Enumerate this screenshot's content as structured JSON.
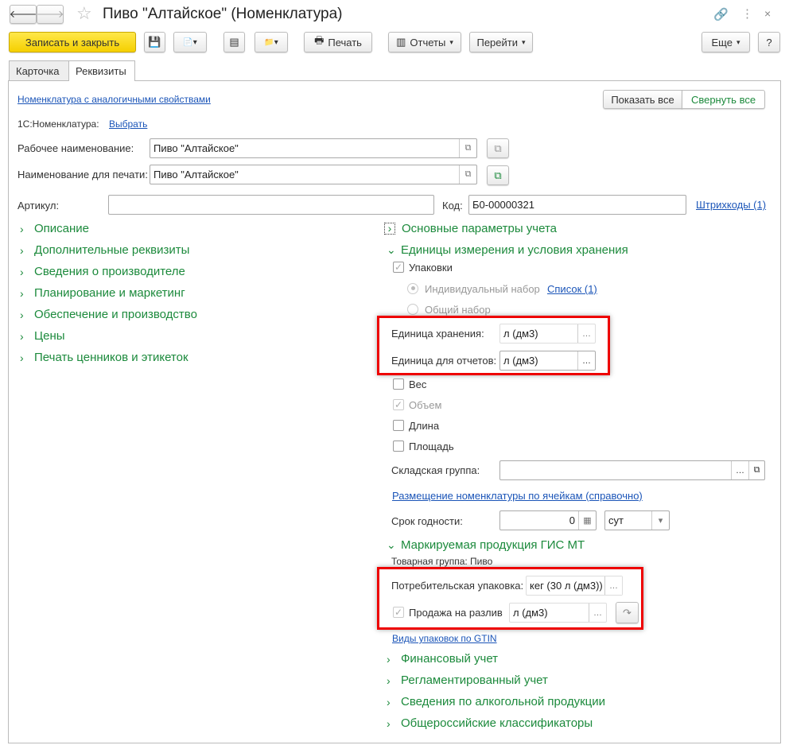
{
  "title": "Пиво \"Алтайское\" (Номенклатура)",
  "toolbar": {
    "save_close": "Записать и закрыть",
    "print": "Печать",
    "reports": "Отчеты",
    "goto": "Перейти",
    "more": "Еще",
    "help": "?"
  },
  "tabs": [
    {
      "label": "Карточка"
    },
    {
      "label": "Реквизиты",
      "active": true
    }
  ],
  "top": {
    "similar_link": "Номенклатура с аналогичными свойствами",
    "show_all": "Показать все",
    "collapse_all": "Свернуть все",
    "nom_label": "1С:Номенклатура:",
    "nom_link": "Выбрать"
  },
  "fields": {
    "work_name_label": "Рабочее наименование:",
    "work_name": "Пиво \"Алтайское\"",
    "print_name_label": "Наименование для печати:",
    "print_name": "Пиво \"Алтайское\"",
    "article_label": "Артикул:",
    "article": "",
    "code_label": "Код:",
    "code": "Б0-00000321",
    "barcodes": "Штрихкоды (1)"
  },
  "left_sections": [
    "Описание",
    "Дополнительные реквизиты",
    "Сведения о производителе",
    "Планирование и маркетинг",
    "Обеспечение и производство",
    "Цены",
    "Печать ценников и этикеток"
  ],
  "right": {
    "basic_params": "Основные параметры учета",
    "units_section": "Единицы измерения и условия хранения",
    "packages": "Упаковки",
    "individual_set": "Индивидуальный набор",
    "list_link": "Список (1)",
    "common_set": "Общий набор",
    "storage_unit_label": "Единица хранения:",
    "storage_unit": "л (дм3)",
    "report_unit_label": "Единица для отчетов:",
    "report_unit": "л (дм3)",
    "weight": "Вес",
    "volume": "Объем",
    "length": "Длина",
    "area": "Площадь",
    "warehouse_group_label": "Складская группа:",
    "warehouse_group": "",
    "placement_link": "Размещение номенклатуры по ячейкам (справочно)",
    "shelf_life_label": "Срок годности:",
    "shelf_life": "0",
    "shelf_unit": "сут",
    "marking_section": "Маркируемая продукция ГИС МТ",
    "product_group": "Товарная группа: Пиво",
    "consumer_pack_label": "Потребительская упаковка:",
    "consumer_pack": "кег (30 л (дм3))",
    "draft_sale": "Продажа на разлив",
    "draft_unit": "л (дм3)",
    "gtin_link": "Виды упаковок по GTIN",
    "bottom_sections": [
      "Финансовый учет",
      "Регламентированный учет",
      "Сведения по алкогольной продукции",
      "Общероссийские классификаторы"
    ]
  },
  "colors": {
    "accent": "#1c8a3c",
    "link": "#1b55b8",
    "highlight": "#ee0000",
    "primary_button": "#f5d000"
  }
}
